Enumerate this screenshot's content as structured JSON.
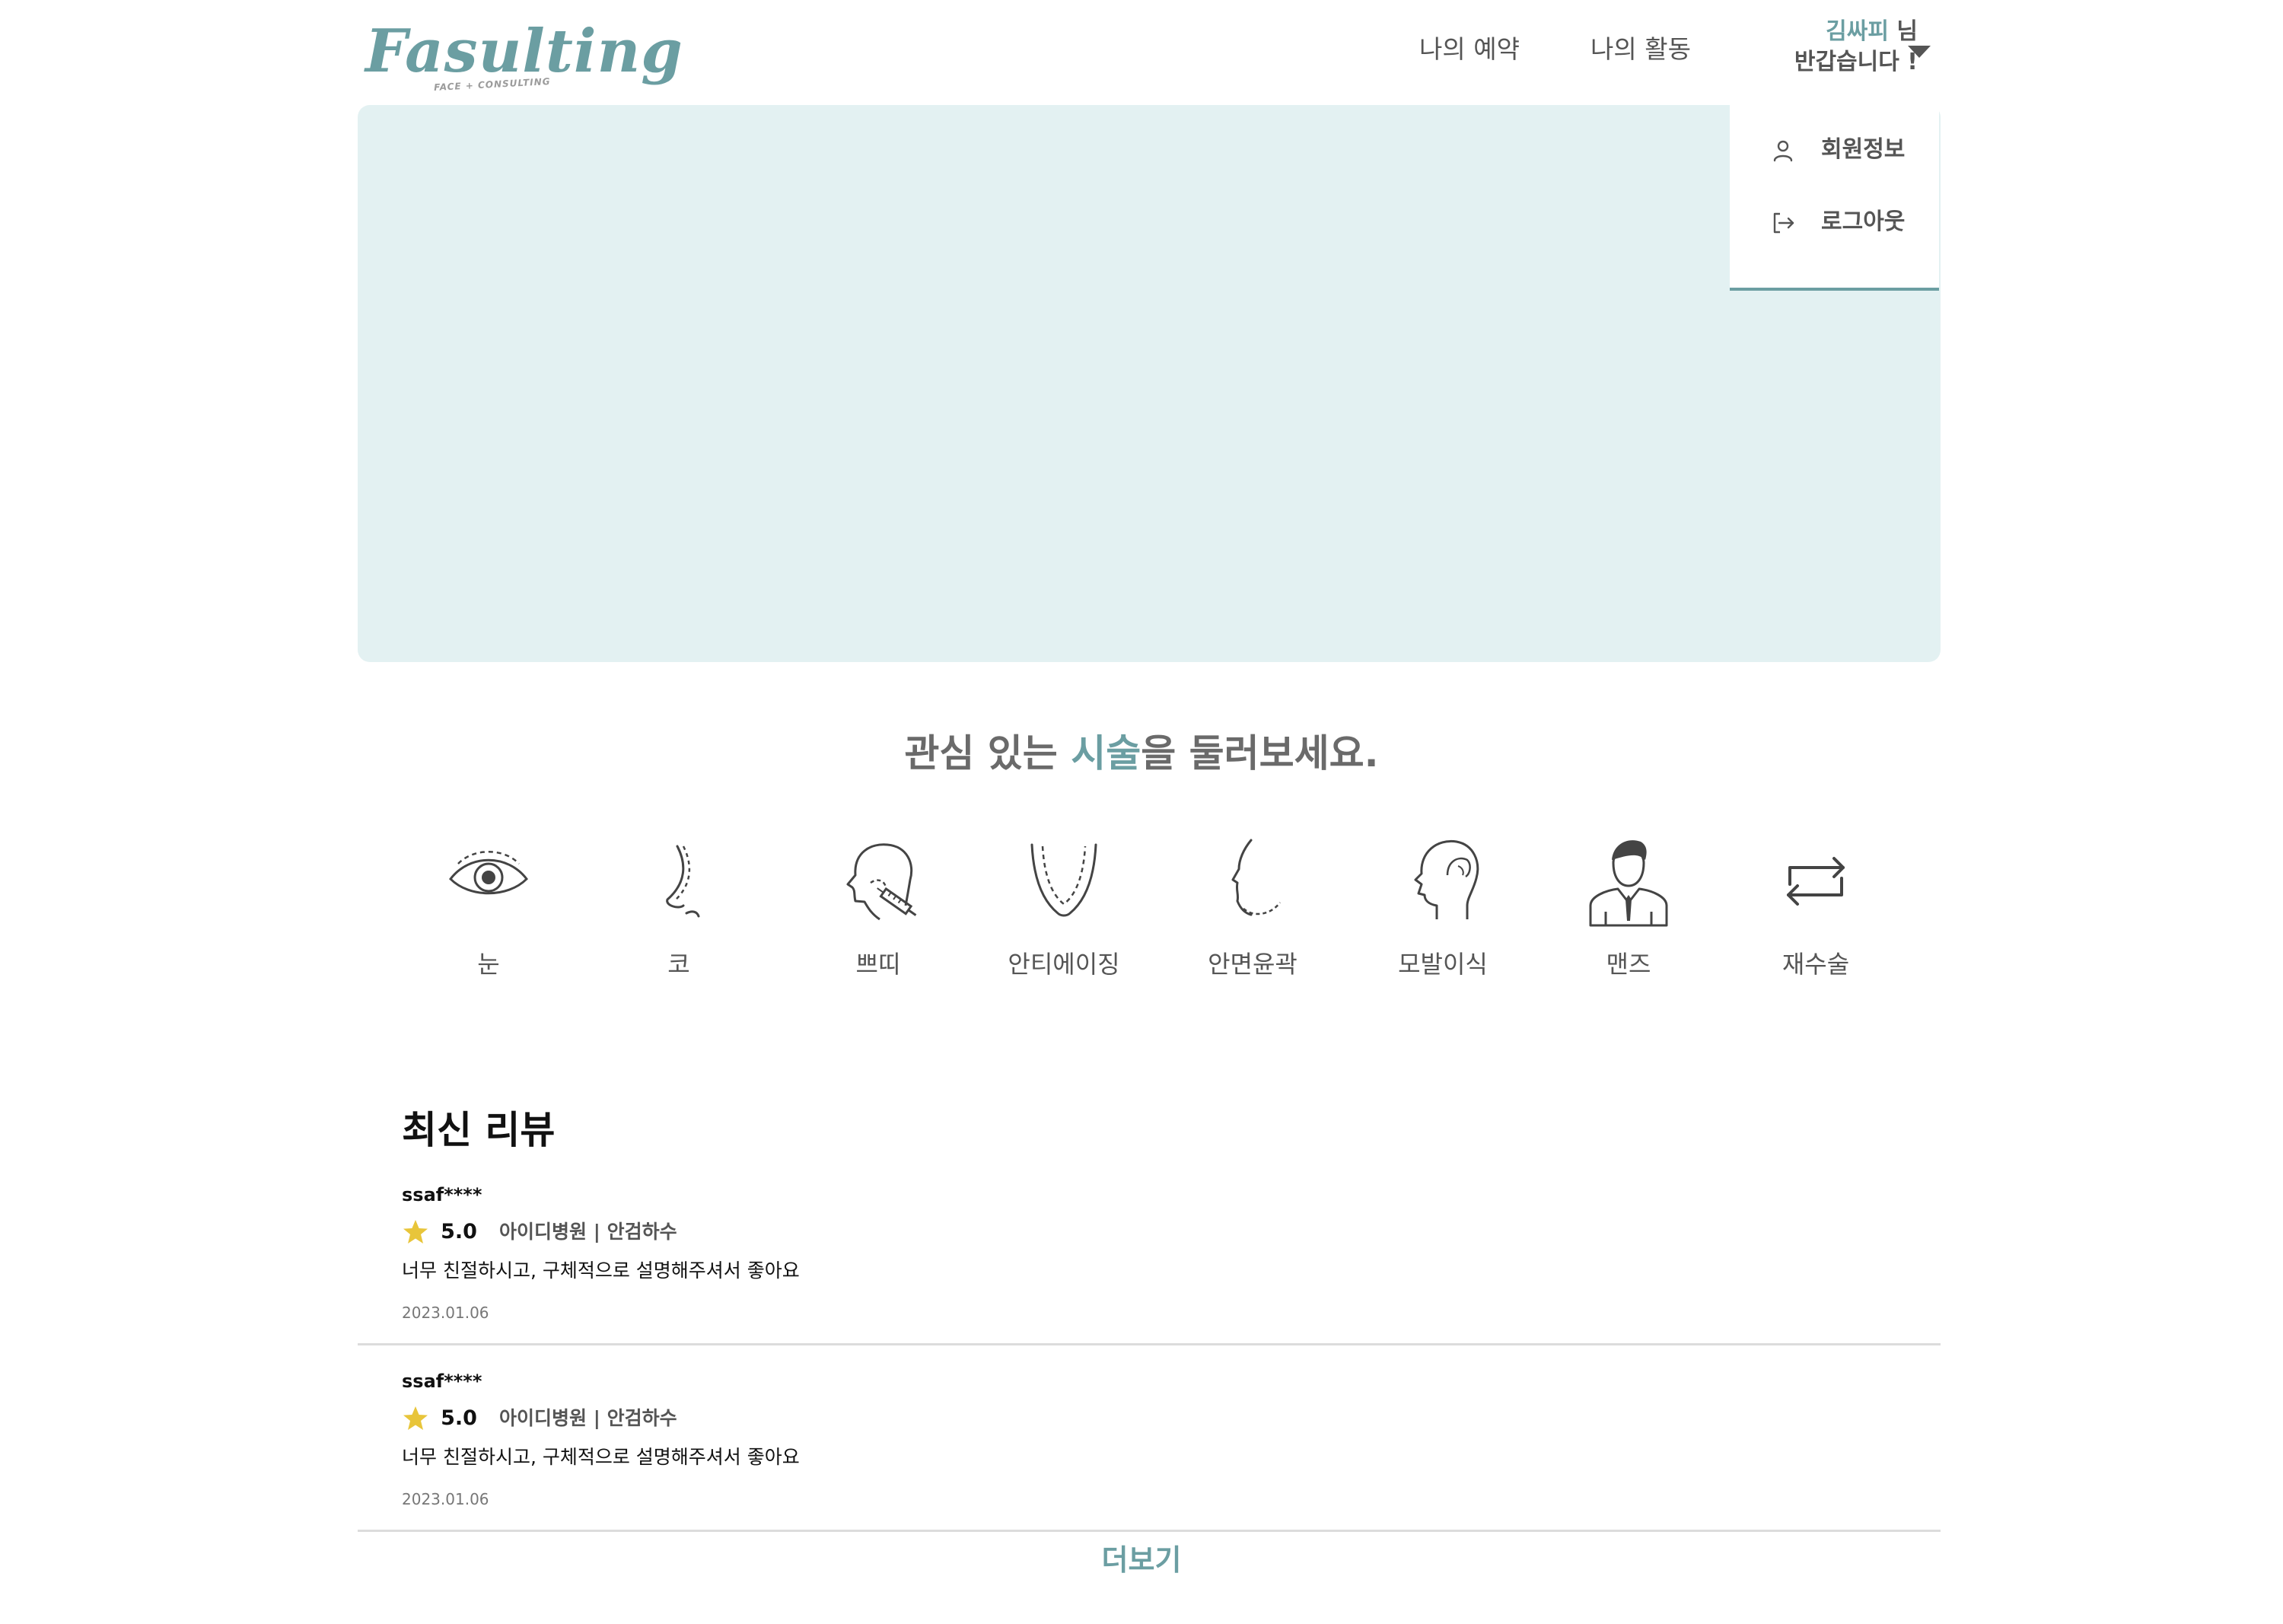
{
  "header": {
    "logo_text": "Fasulting",
    "logo_subtext": "FACE + CONSULTING",
    "nav": {
      "reservation": "나의 예약",
      "activity": "나의 활동"
    },
    "greeting": {
      "user_name": "김싸피",
      "honorific": " 님",
      "welcome": "반갑습니다 !"
    },
    "dropdown": {
      "profile": "회원정보",
      "logout": "로그아웃"
    }
  },
  "section": {
    "heading_before": "관심 있는 ",
    "heading_accent": "시술",
    "heading_after": "을 둘러보세요."
  },
  "categories": [
    {
      "label": "눈",
      "icon": "eye-icon"
    },
    {
      "label": "코",
      "icon": "nose-icon"
    },
    {
      "label": "쁘띠",
      "icon": "petit-injection-icon"
    },
    {
      "label": "안티에이징",
      "icon": "anti-aging-face-icon"
    },
    {
      "label": "안면윤곽",
      "icon": "face-contour-icon"
    },
    {
      "label": "모발이식",
      "icon": "hair-transplant-icon"
    },
    {
      "label": "맨즈",
      "icon": "mens-icon"
    },
    {
      "label": "재수술",
      "icon": "redo-arrows-icon"
    }
  ],
  "reviews": {
    "title": "최신 리뷰",
    "items": [
      {
        "author": "ssaf****",
        "rating": "5.0",
        "hospital": "아이디병원 | 안검하수",
        "content": "너무 친절하시고, 구체적으로 설명해주셔서 좋아요",
        "date": "2023.01.06"
      },
      {
        "author": "ssaf****",
        "rating": "5.0",
        "hospital": "아이디병원 | 안검하수",
        "content": "너무 친절하시고, 구체적으로 설명해주셔서 좋아요",
        "date": "2023.01.06"
      }
    ],
    "more_label": "더보기"
  },
  "colors": {
    "accent": "#6b9ea2",
    "hero_bg": "#e3f1f2",
    "star": "#e8c53a"
  }
}
